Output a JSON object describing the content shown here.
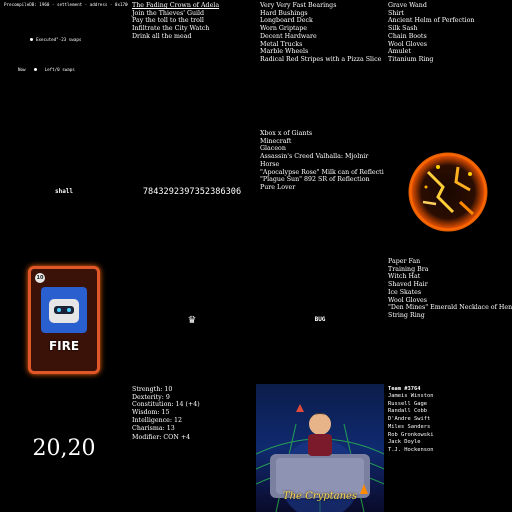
{
  "tile_r0c0": {
    "header": "PrecompileDB: 1960 · settlement · address · 0x1700...",
    "executed_line": "Executed\"-23 swaps",
    "bullet_icon": "bullet-icon",
    "now_label": "Now",
    "left_line": "Left/0 swaps"
  },
  "quests": [
    "The Fading Crown of Adela",
    "Join the Thieves' Guild",
    "Pay the toll to the troll",
    "Infiltrate the City Watch",
    "Drink all the mead"
  ],
  "skate_parts": [
    "Very Very Fast Bearings",
    "Hard Bushings",
    "Longboard Deck",
    "Worn Griptape",
    "Decent Hardware",
    "Metal Trucks",
    "Marble Wheels",
    "Radical Red Stripes with a Pizza Slice"
  ],
  "loot_r0c3": [
    "Grave Wand",
    "Shirt",
    "Ancient Helm of Perfection",
    "Silk Sash",
    "Chain Boots",
    "Wool Gloves",
    "Amulet",
    "Titanium Ring"
  ],
  "tile_r1c0": {
    "word": "shall"
  },
  "tile_r1c1": {
    "number": "7843292397352386306"
  },
  "games": [
    "Xbox x of Giants",
    "Minecraft",
    "Glaceon",
    "Assassin's Creed Valhalla: Mjolnir",
    "Horse",
    "\"Apocalypse Rose\" Milk can of Reflection",
    "\"Plague Sun\" 892 SR of Reflection",
    "Pure Lover"
  ],
  "tile_r1c3": {
    "icon": "flaming-orb-icon"
  },
  "card": {
    "value": "10",
    "title": "FIRE"
  },
  "tile_r2c1": {
    "glyph": "♛"
  },
  "tile_r2c2": {
    "word": "BUG"
  },
  "loot_r2c3": [
    "Paper Fan",
    "Training Bra",
    "Witch Hat",
    "Shaved Hair",
    "Ice Skates",
    "Wool Gloves",
    "\"Den Mines\" Emerald Necklace of Hentai Queen",
    "String Ring"
  ],
  "tile_r3c0": {
    "coords": "20,20"
  },
  "stats": [
    "Strength: 10",
    "Dexterity: 9",
    "Constitution: 14 (+4)",
    "Wisdom: 15",
    "Intelligence: 12",
    "Charisma: 13"
  ],
  "modifier": "Modifier: CON +4",
  "crypt": {
    "title": "The Cryptanes"
  },
  "team": {
    "title": "Team #3764",
    "members": [
      "Jameis Winston",
      "Russell Gage",
      "Randall Cobb",
      "D'Andre Swift",
      "Miles Sanders",
      "Rob Gronkowski",
      "Jack Doyle",
      "T.J. Hockenson"
    ]
  },
  "colors": {
    "bg": "#000000",
    "text": "#ffffff",
    "fire_orange": "#ff6a00",
    "card_border": "#e0582a"
  }
}
